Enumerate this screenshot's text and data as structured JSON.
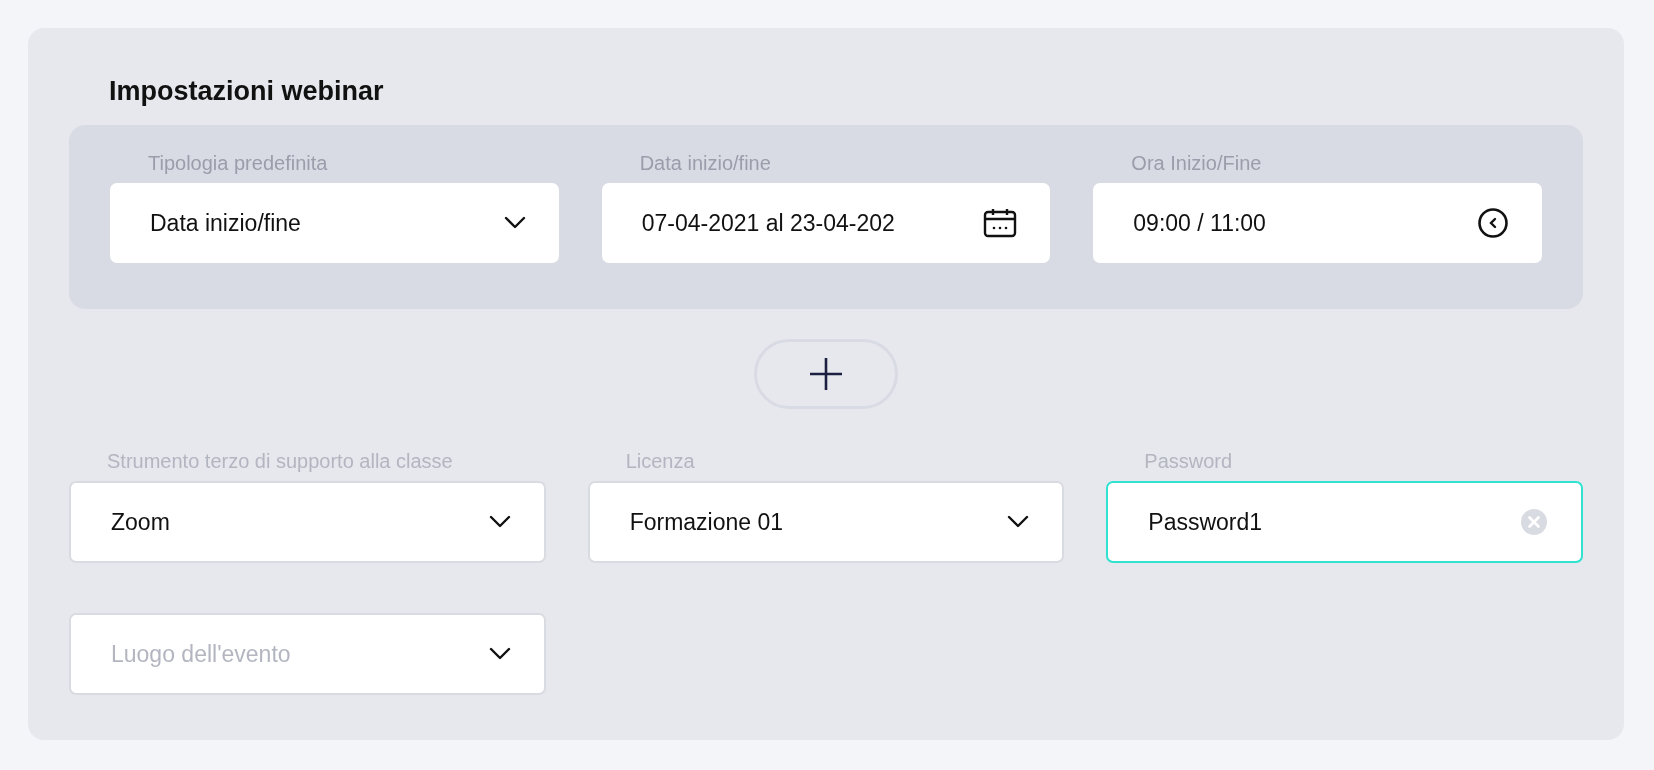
{
  "title": "Impostazioni webinar",
  "date_group": [
    {
      "label": "Tipologia predefinita",
      "value": "Data inizio/fine",
      "kind": "select"
    },
    {
      "label": "Data inizio/fine",
      "value": "07-04-2021 al 23-04-202",
      "kind": "date"
    },
    {
      "label": "Ora Inizio/Fine",
      "value": "09:00 / 11:00",
      "kind": "time"
    }
  ],
  "fields": [
    {
      "label": "Strumento terzo di supporto alla classe",
      "value": "Zoom",
      "kind": "select",
      "focused": false
    },
    {
      "label": "Licenza",
      "value": "Formazione 01",
      "kind": "select",
      "focused": false
    },
    {
      "label": "Password",
      "value": "Password1",
      "kind": "clearable",
      "focused": true
    },
    {
      "placeholder": "Luogo dell'evento",
      "kind": "select",
      "focused": false
    }
  ]
}
